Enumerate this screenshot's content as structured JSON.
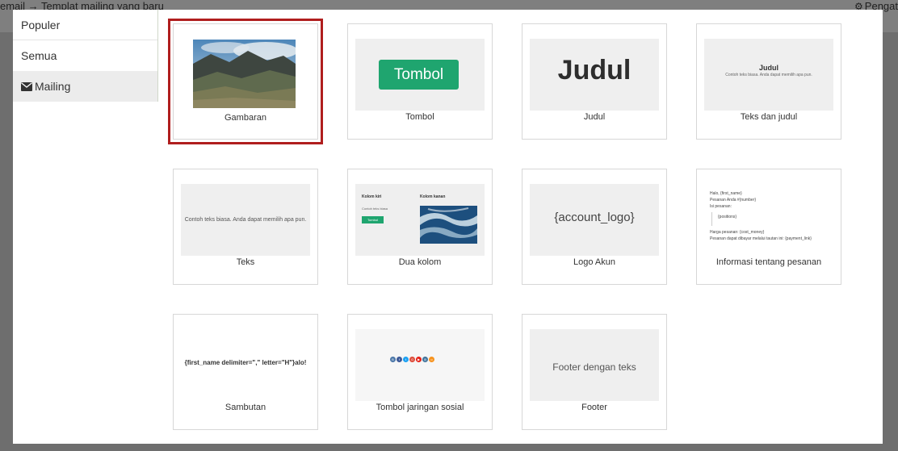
{
  "header": {
    "breadcrumb": "email → Templat mailing yang baru",
    "settings_label": "Pengat",
    "settings_icon": "gear-icon"
  },
  "sidebar": {
    "items": [
      {
        "label": "Populer"
      },
      {
        "label": "Semua"
      },
      {
        "label": "Mailing",
        "icon": "envelope-icon",
        "active": true
      }
    ]
  },
  "cards": [
    {
      "label": "Gambaran",
      "selected": true
    },
    {
      "label": "Tombol",
      "preview_text": "Tombol"
    },
    {
      "label": "Judul",
      "preview_text": "Judul"
    },
    {
      "label": "Teks dan judul",
      "preview_title": "Judul",
      "preview_body": "Contoh teks biasa. Anda dapat memilih apa pun."
    },
    {
      "label": "Teks",
      "preview_text": "Contoh teks biasa. Anda dapat memilih apa pun."
    },
    {
      "label": "Dua kolom",
      "left_head": "Kolom kiri",
      "left_text": "Contoh teks biasa",
      "left_button": "Tombol",
      "right_head": "Kolom kanan"
    },
    {
      "label": "Logo Akun",
      "preview_text": "{account_logo}"
    },
    {
      "label": "Informasi tentang pesanan",
      "lines": [
        "Halo, {first_name}",
        "Pesanan Anda #{number}",
        "Isi pesanan:",
        "{positions}",
        "Harga pesanan: {cost_money}",
        "Pesanan dapat dibayar melalui tautan ini: {payment_link}"
      ]
    },
    {
      "label": "Sambutan",
      "preview_text": "{first_name delimiter=\",\" letter=\"H\"}alo!"
    },
    {
      "label": "Tombol jaringan sosial",
      "icons": [
        {
          "name": "vk-icon",
          "color": "#4a76a8",
          "glyph": "B"
        },
        {
          "name": "facebook-icon",
          "color": "#3b5998",
          "glyph": "f"
        },
        {
          "name": "twitter-icon",
          "color": "#1da1f2",
          "glyph": "t"
        },
        {
          "name": "google-plus-icon",
          "color": "#dd4b39",
          "glyph": "G"
        },
        {
          "name": "youtube-icon",
          "color": "#e62117",
          "glyph": "▶"
        },
        {
          "name": "instagram-icon",
          "color": "#3f729b",
          "glyph": "◎"
        },
        {
          "name": "odnoklassniki-icon",
          "color": "#f7931e",
          "glyph": "o"
        }
      ]
    },
    {
      "label": "Footer",
      "preview_text": "Footer dengan teks"
    }
  ],
  "colors": {
    "accent_green": "#1fa56f",
    "selected_outline": "#b01e1e",
    "overlay": "#6e6e6e"
  }
}
